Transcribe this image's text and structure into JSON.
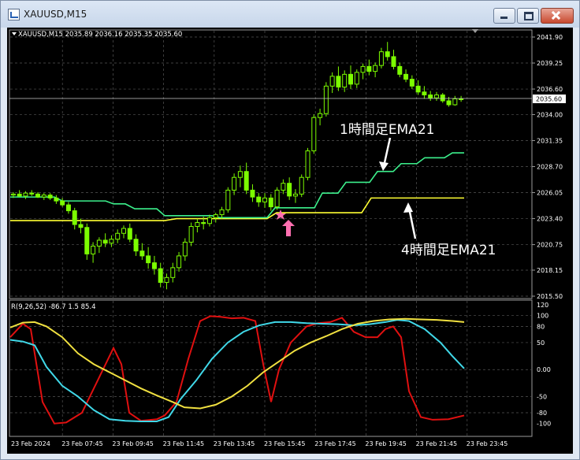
{
  "window": {
    "title": "XAUUSD,M15"
  },
  "chart": {
    "header": "XAUUSD,M15  2035.89 2036.16 2035.35 2035.60",
    "current_price": "2035.60",
    "price_ticks": [
      "2041.90",
      "2039.25",
      "2036.60",
      "2034.00",
      "2031.35",
      "2028.70",
      "2026.05",
      "2023.40",
      "2020.75",
      "2018.15",
      "2015.50"
    ]
  },
  "annotations": {
    "ema1h_label": "1時間足EMA21",
    "ema4h_label": "4時間足EMA21"
  },
  "oscillator": {
    "header": "R(9,26,52) -86.7 1.5 85.4",
    "ticks": [
      "120",
      "100",
      "80",
      "50",
      "0.00",
      "-50",
      "-80",
      "-100"
    ]
  },
  "time_axis": [
    "23 Feb 2024",
    "23 Feb 07:45",
    "23 Feb 09:45",
    "23 Feb 11:45",
    "23 Feb 13:45",
    "23 Feb 15:45",
    "23 Feb 17:45",
    "23 Feb 19:45",
    "23 Feb 21:45",
    "23 Feb 23:45"
  ],
  "colors": {
    "background": "#000000",
    "candle": "#7CFC00",
    "ema1h": "#3CF08C",
    "ema4h": "#FFFF33",
    "osc_red": "#E01010",
    "osc_cyan": "#40D8E8",
    "osc_yellow": "#F0E040",
    "marker": "#FF6FB0"
  },
  "candles": [
    [
      2025.8,
      2026.1,
      2025.5,
      2025.9
    ],
    [
      2025.9,
      2026.3,
      2025.6,
      2025.7
    ],
    [
      2025.7,
      2026.2,
      2025.4,
      2026.0
    ],
    [
      2026.0,
      2026.3,
      2025.7,
      2025.9
    ],
    [
      2025.9,
      2026.1,
      2025.5,
      2025.6
    ],
    [
      2025.6,
      2026.0,
      2025.3,
      2025.8
    ],
    [
      2025.8,
      2026.0,
      2025.3,
      2025.5
    ],
    [
      2025.5,
      2025.8,
      2024.9,
      2025.2
    ],
    [
      2025.2,
      2025.5,
      2024.6,
      2024.8
    ],
    [
      2024.8,
      2025.1,
      2023.9,
      2024.2
    ],
    [
      2024.2,
      2024.5,
      2022.3,
      2022.8
    ],
    [
      2022.8,
      2023.4,
      2021.9,
      2022.5
    ],
    [
      2022.5,
      2022.9,
      2019.2,
      2019.8
    ],
    [
      2019.8,
      2021.0,
      2018.9,
      2020.6
    ],
    [
      2020.6,
      2021.5,
      2019.9,
      2021.2
    ],
    [
      2021.2,
      2021.9,
      2020.5,
      2020.9
    ],
    [
      2020.9,
      2021.7,
      2020.5,
      2021.3
    ],
    [
      2021.3,
      2022.3,
      2020.9,
      2021.9
    ],
    [
      2021.9,
      2022.7,
      2021.4,
      2022.4
    ],
    [
      2022.4,
      2022.9,
      2021.0,
      2021.3
    ],
    [
      2021.3,
      2021.8,
      2019.6,
      2020.1
    ],
    [
      2020.1,
      2020.9,
      2019.2,
      2019.6
    ],
    [
      2019.6,
      2020.5,
      2018.3,
      2018.9
    ],
    [
      2018.9,
      2019.6,
      2017.7,
      2018.3
    ],
    [
      2018.3,
      2018.9,
      2016.4,
      2016.9
    ],
    [
      2016.9,
      2017.8,
      2016.2,
      2017.4
    ],
    [
      2017.4,
      2018.9,
      2016.9,
      2018.4
    ],
    [
      2018.4,
      2020.0,
      2018.0,
      2019.6
    ],
    [
      2019.6,
      2021.4,
      2019.1,
      2021.0
    ],
    [
      2021.0,
      2023.0,
      2020.6,
      2022.6
    ],
    [
      2022.6,
      2023.4,
      2022.0,
      2023.0
    ],
    [
      2023.0,
      2023.6,
      2022.3,
      2022.9
    ],
    [
      2022.9,
      2023.8,
      2022.6,
      2023.5
    ],
    [
      2023.5,
      2024.0,
      2023.0,
      2023.8
    ],
    [
      2023.8,
      2024.6,
      2023.4,
      2024.3
    ],
    [
      2024.3,
      2026.6,
      2024.0,
      2026.3
    ],
    [
      2026.3,
      2028.0,
      2025.8,
      2027.6
    ],
    [
      2027.6,
      2028.8,
      2026.6,
      2028.2
    ],
    [
      2028.2,
      2029.1,
      2025.9,
      2026.3
    ],
    [
      2026.3,
      2026.9,
      2025.1,
      2025.6
    ],
    [
      2025.6,
      2026.0,
      2024.6,
      2025.1
    ],
    [
      2025.1,
      2026.0,
      2024.5,
      2025.5
    ],
    [
      2025.5,
      2025.9,
      2024.2,
      2024.6
    ],
    [
      2024.6,
      2026.6,
      2024.3,
      2026.3
    ],
    [
      2026.3,
      2027.4,
      2025.9,
      2027.0
    ],
    [
      2027.0,
      2027.6,
      2025.3,
      2025.7
    ],
    [
      2025.7,
      2026.4,
      2025.0,
      2025.9
    ],
    [
      2025.9,
      2027.9,
      2025.6,
      2027.6
    ],
    [
      2027.6,
      2030.6,
      2027.3,
      2030.3
    ],
    [
      2030.3,
      2034.0,
      2030.0,
      2033.7
    ],
    [
      2033.7,
      2034.6,
      2032.9,
      2034.1
    ],
    [
      2034.1,
      2037.3,
      2033.8,
      2036.9
    ],
    [
      2036.9,
      2038.3,
      2036.2,
      2037.9
    ],
    [
      2037.9,
      2038.9,
      2036.4,
      2036.8
    ],
    [
      2036.8,
      2038.5,
      2036.3,
      2038.1
    ],
    [
      2038.1,
      2039.0,
      2036.6,
      2037.1
    ],
    [
      2037.1,
      2038.6,
      2036.7,
      2038.3
    ],
    [
      2038.3,
      2039.2,
      2037.6,
      2038.9
    ],
    [
      2038.9,
      2039.6,
      2038.0,
      2038.4
    ],
    [
      2038.4,
      2039.3,
      2037.8,
      2039.0
    ],
    [
      2039.0,
      2040.8,
      2038.7,
      2040.4
    ],
    [
      2040.4,
      2041.4,
      2039.5,
      2039.9
    ],
    [
      2039.9,
      2040.6,
      2038.6,
      2038.9
    ],
    [
      2038.9,
      2039.3,
      2037.8,
      2038.1
    ],
    [
      2038.1,
      2038.6,
      2037.3,
      2037.6
    ],
    [
      2037.6,
      2038.0,
      2036.6,
      2036.9
    ],
    [
      2036.9,
      2037.5,
      2036.0,
      2036.3
    ],
    [
      2036.3,
      2036.9,
      2035.6,
      2036.0
    ],
    [
      2036.0,
      2036.4,
      2035.4,
      2035.7
    ],
    [
      2035.7,
      2036.3,
      2035.4,
      2036.0
    ],
    [
      2036.0,
      2036.2,
      2035.2,
      2035.4
    ],
    [
      2035.4,
      2035.8,
      2034.8,
      2035.0
    ],
    [
      2035.0,
      2035.9,
      2034.9,
      2035.6
    ],
    [
      2035.6,
      2035.9,
      2035.3,
      2035.6
    ]
  ]
}
